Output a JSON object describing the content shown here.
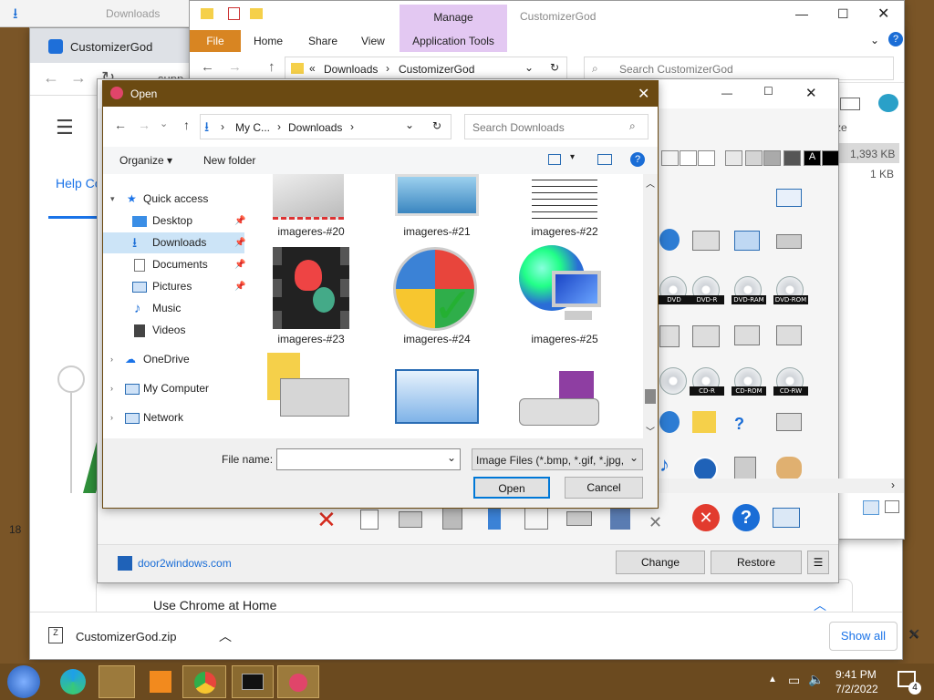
{
  "chrome": {
    "window_title": "CustomizerGod",
    "nav_help": "Help Co",
    "address_partial": "supp",
    "footer_heading": "Use Chrome at Home",
    "download_file": "CustomizerGod.zip",
    "show_all": "Show all",
    "left_edge_num": "18"
  },
  "explorer": {
    "ribbon_group": "Manage",
    "title": "CustomizerGod",
    "tabs": [
      "File",
      "Home",
      "Share",
      "View",
      "Application Tools"
    ],
    "breadcrumb": [
      "Downloads",
      "CustomizerGod"
    ],
    "breadcrumb_prefix": "«",
    "search_placeholder": "Search CustomizerGod",
    "size_header": "ze",
    "sizes": [
      "1,393 KB",
      "1 KB"
    ],
    "top_tab_text": "Downloads"
  },
  "customizer": {
    "website": "door2windows.com",
    "change_label": "Change",
    "restore_label": "Restore",
    "menu_label": "☰",
    "disc_labels": [
      "DVD",
      "DVD-R",
      "DVD-RAM",
      "DVD-ROM",
      "CD-R",
      "CD-ROM",
      "CD-RW"
    ]
  },
  "dialog": {
    "title": "Open",
    "path": [
      "My C...",
      "Downloads"
    ],
    "search_placeholder": "Search Downloads",
    "organize": "Organize ▾",
    "new_folder": "New folder",
    "nav": {
      "quick_access": "Quick access",
      "items": [
        "Desktop",
        "Downloads",
        "Documents",
        "Pictures",
        "Music",
        "Videos"
      ],
      "onedrive": "OneDrive",
      "my_computer": "My Computer",
      "network": "Network"
    },
    "thumbs": [
      "imageres-#20",
      "imageres-#21",
      "imageres-#22",
      "imageres-#23",
      "imageres-#24",
      "imageres-#25"
    ],
    "file_name_label": "File name:",
    "file_name_value": "",
    "file_type": "Image Files (*.bmp, *.gif, *.jpg,",
    "open_label": "Open",
    "cancel_label": "Cancel"
  },
  "taskbar": {
    "time": "9:41 PM",
    "date": "7/2/2022",
    "notif_count": "4"
  },
  "colors": {
    "accent": "#1a73e8",
    "dialog_title": "#6b4a12",
    "explorer_manage": "#e3c8f2",
    "close_red": "#e81123"
  }
}
